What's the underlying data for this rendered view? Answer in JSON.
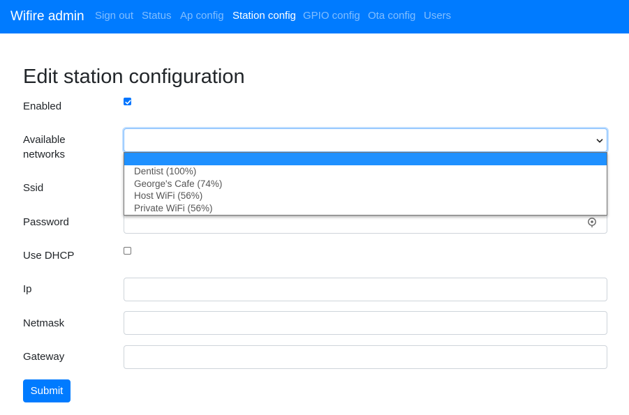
{
  "navbar": {
    "brand": "Wifire admin",
    "links": [
      {
        "label": "Sign out"
      },
      {
        "label": "Status"
      },
      {
        "label": "Ap config"
      },
      {
        "label": "Station config",
        "active": true
      },
      {
        "label": "GPIO config"
      },
      {
        "label": "Ota config"
      },
      {
        "label": "Users"
      }
    ]
  },
  "page": {
    "title": "Edit station configuration"
  },
  "form": {
    "enabled": {
      "label": "Enabled",
      "checked": true
    },
    "available_networks": {
      "label_line1": "Available",
      "label_line2": "networks",
      "selected_value": "",
      "options": [
        "",
        "Dentist (100%)",
        "George's Cafe (74%)",
        "Host WiFi (56%)",
        "Private WiFi (56%)"
      ]
    },
    "ssid": {
      "label": "Ssid",
      "value": ""
    },
    "password": {
      "label": "Password",
      "value": "",
      "icon": "eye-reveal-icon"
    },
    "use_dhcp": {
      "label": "Use DHCP",
      "checked": false
    },
    "ip": {
      "label": "Ip",
      "value": ""
    },
    "netmask": {
      "label": "Netmask",
      "value": ""
    },
    "gateway": {
      "label": "Gateway",
      "value": ""
    },
    "submit_label": "Submit"
  },
  "colors": {
    "primary": "#007bff",
    "nav_inactive": "rgba(255,255,255,0.5)",
    "dropdown_highlight": "#1e90ff"
  }
}
